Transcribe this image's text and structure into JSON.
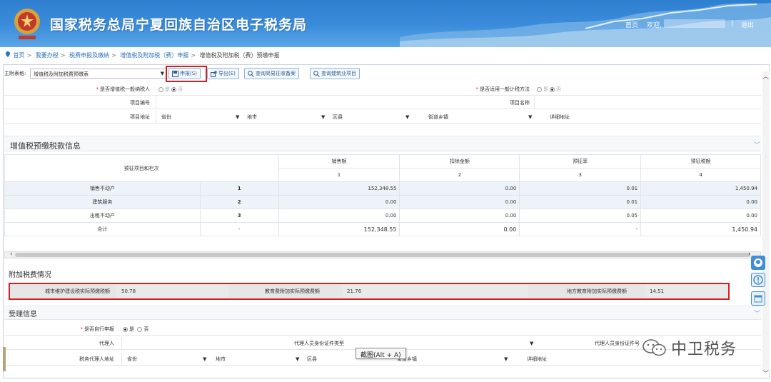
{
  "header": {
    "title": "国家税务总局宁夏回族自治区电子税务局",
    "home": "首页",
    "welcome": "欢迎,",
    "separator": "|",
    "logout": "退出"
  },
  "breadcrumb": {
    "items": [
      "首页",
      "我要办税",
      "税费申报及缴纳",
      "增值税及附加税（费）申报"
    ],
    "current": "增值税及附加税（费）预缴申报"
  },
  "toolbar": {
    "main_form_label": "主附表格:",
    "main_form_value": "增值税及附加税费预缴表",
    "declare_label": "申报(S)",
    "export_label": "导出(E)",
    "query_simple_label": "查询简易征收备案",
    "query_construction_label": "查询建筑业项目"
  },
  "basic": {
    "vat_general_label": "是否增值税一般纳税人",
    "yes": "是",
    "no": "否",
    "general_method_label": "是否适用一般计税方法",
    "project_no_label": "项目编号",
    "project_name_label": "项目名称",
    "project_address_label": "项目地址",
    "province": "省份",
    "city": "地市",
    "district": "区县",
    "street": "街道乡镇",
    "detail_address": "详细地址"
  },
  "vat_section": {
    "title": "增值税预缴税款信息",
    "col_item": "预征项目和栏次",
    "col_sales": "销售额",
    "col_deduction": "扣除金额",
    "col_rate": "预征率",
    "col_tax": "预征税额",
    "col_idx": [
      "1",
      "2",
      "3",
      "4"
    ],
    "rows": [
      {
        "name": "销售不动产",
        "line": "1",
        "sales": "152,348.55",
        "deduction": "0.00",
        "rate": "0.01",
        "tax": "1,450.94"
      },
      {
        "name": "建筑服务",
        "line": "2",
        "sales": "0.00",
        "deduction": "0.00",
        "rate": "0.01",
        "tax": "0.00"
      },
      {
        "name": "出租不动产",
        "line": "3",
        "sales": "0.00",
        "deduction": "0.00",
        "rate": "0.05",
        "tax": "0.00"
      },
      {
        "name": "合计",
        "line": "-",
        "sales": "152,348.55",
        "deduction": "0.00",
        "rate": "-",
        "tax": "1,450.94"
      }
    ]
  },
  "surcharge": {
    "title": "附加税费情况",
    "urban_label": "城市维护建设税实际预缴税额",
    "urban_value": "50.78",
    "edu_label": "教育费附加实际预缴费额",
    "edu_value": "21.76",
    "local_edu_label": "地方教育附加实际预缴费额",
    "local_edu_value": "14.51"
  },
  "acceptance": {
    "title": "受理信息",
    "self_declare_label": "是否自行申报",
    "yes": "是",
    "no": "否",
    "agent_label": "代理人",
    "agent_id_type_label": "代理人员身份证件类型",
    "agent_id_no_label": "代理人员身份证件号",
    "agent_address_label": "税务代理人地址",
    "province": "省份",
    "city": "地市",
    "district": "区县",
    "street": "街道乡镇",
    "detail_address": "详细地址"
  },
  "tooltip": "截图(Alt + A)",
  "watermark": "中卫税务",
  "colors": {
    "header_blue": "#3b8ddb",
    "highlight_red": "#d71f1f",
    "link_blue": "#2a6fb8"
  }
}
